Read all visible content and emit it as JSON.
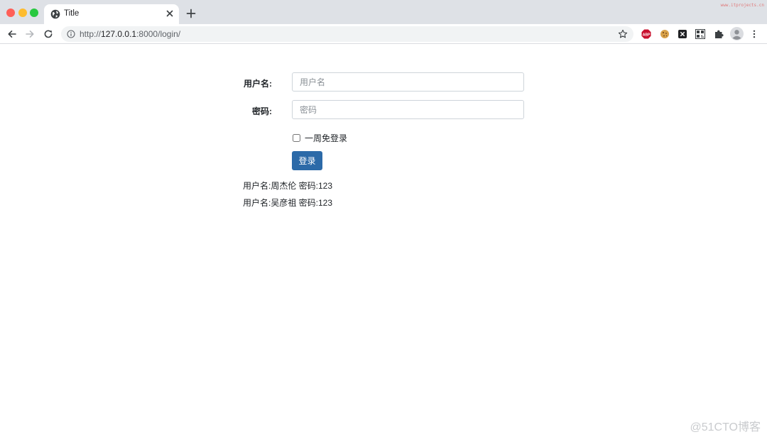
{
  "browser": {
    "tab_title": "Title",
    "corner_mark": "www.itprojects.cn",
    "url_scheme": "http://",
    "url_host": "127.0.0.1",
    "url_path": ":8000/login/",
    "extensions": [
      "adblock-plus-icon",
      "cookie-icon",
      "x-extension-icon",
      "qr-code-icon",
      "puzzle-extensions-icon",
      "profile-avatar-icon",
      "more-menu-icon"
    ]
  },
  "login_form": {
    "username_label": "用户名:",
    "username_placeholder": "用户名",
    "username_value": "",
    "password_label": "密码:",
    "password_placeholder": "密码",
    "password_value": "",
    "remember_label": "一周免登录",
    "remember_checked": false,
    "submit_label": "登录"
  },
  "accounts": [
    {
      "text": "用户名:周杰伦 密码:123"
    },
    {
      "text": "用户名:吴彦祖 密码:123"
    }
  ],
  "watermark": "@51CTO博客",
  "colors": {
    "primary_button": "#2c6aa8",
    "tabbar_bg": "#dee1e6",
    "omnibox_bg": "#f1f3f4",
    "input_border": "#ced4da"
  }
}
